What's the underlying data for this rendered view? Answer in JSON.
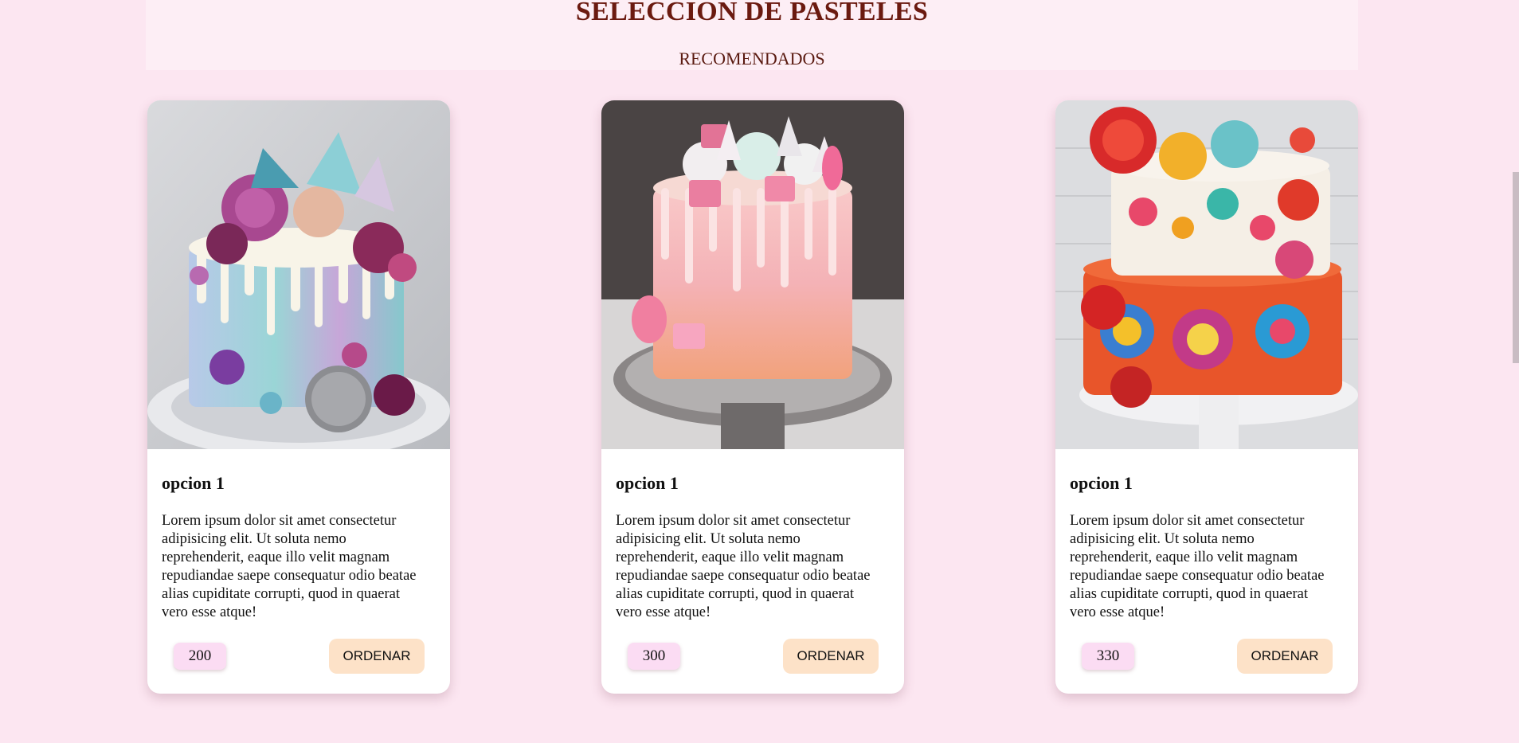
{
  "header": {
    "title": "SELECCION DE PASTELES",
    "subtitle": "RECOMENDADOS"
  },
  "cards": [
    {
      "title": "opcion 1",
      "text": "Lorem ipsum dolor sit amet consectetur adipisicing elit. Ut soluta nemo reprehenderit, eaque illo velit magnam repudiandae saepe consequatur odio beatae alias cupiditate corrupti, quod in quaerat vero esse atque!",
      "price": "200",
      "button_label": "ORDENAR"
    },
    {
      "title": "opcion 1",
      "text": "Lorem ipsum dolor sit amet consectetur adipisicing elit. Ut soluta nemo reprehenderit, eaque illo velit magnam repudiandae saepe consequatur odio beatae alias cupiditate corrupti, quod in quaerat vero esse atque!",
      "price": "300",
      "button_label": "ORDENAR"
    },
    {
      "title": "opcion 1",
      "text": "Lorem ipsum dolor sit amet consectetur adipisicing elit. Ut soluta nemo reprehenderit, eaque illo velit magnam repudiandae saepe consequatur odio beatae alias cupiditate corrupti, quod in quaerat vero esse atque!",
      "price": "330",
      "button_label": "ORDENAR"
    }
  ],
  "colors": {
    "page_background": "#fce6f1",
    "header_background": "#fdeef5",
    "title_color": "#6b1a10",
    "price_badge": "#fbdcf3",
    "order_button": "#fde2c8"
  }
}
